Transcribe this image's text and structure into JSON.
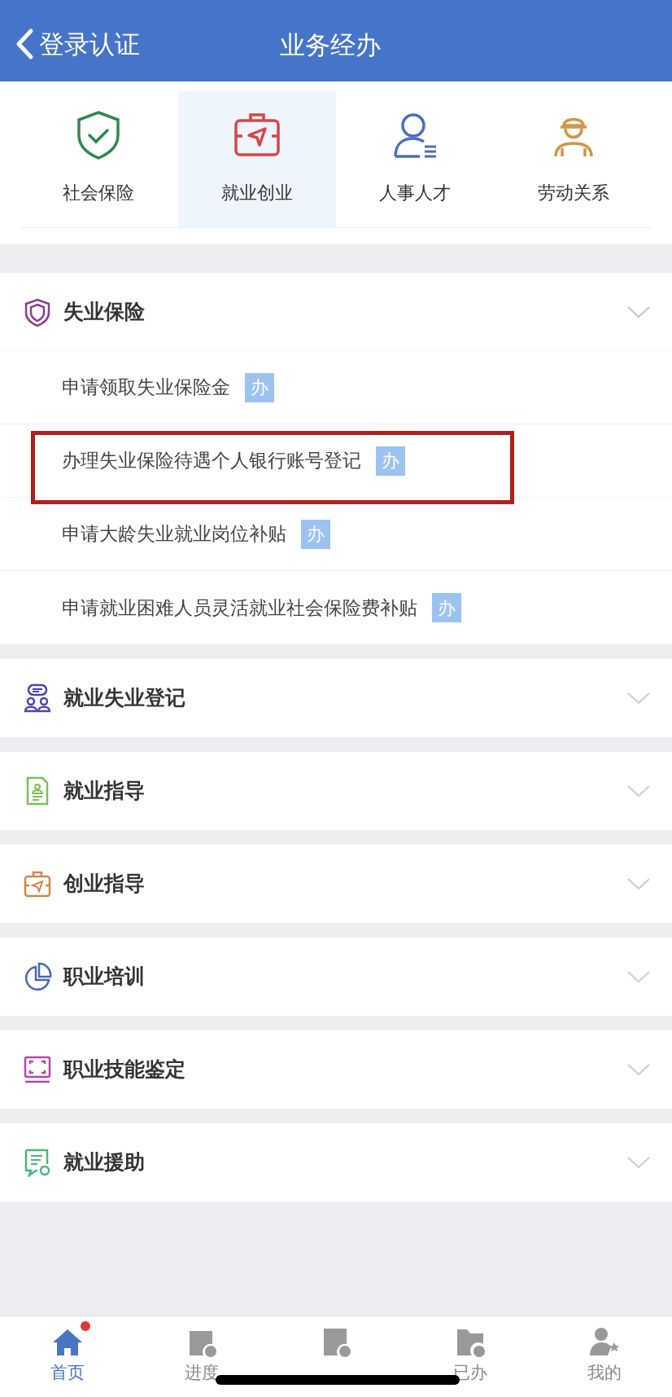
{
  "header": {
    "back_label": "登录认证",
    "title": "业务经办"
  },
  "categories": [
    {
      "label": "社会保险",
      "selected": false
    },
    {
      "label": "就业创业",
      "selected": true
    },
    {
      "label": "人事人才",
      "selected": false
    },
    {
      "label": "劳动关系",
      "selected": false
    }
  ],
  "sections": [
    {
      "title": "失业保险",
      "expanded": true,
      "items": [
        {
          "label": "申请领取失业保险金",
          "badge": "办",
          "highlighted": false
        },
        {
          "label": "办理失业保险待遇个人银行账号登记",
          "badge": "办",
          "highlighted": true
        },
        {
          "label": "申请大龄失业就业岗位补贴",
          "badge": "办",
          "highlighted": false
        },
        {
          "label": "申请就业困难人员灵活就业社会保险费补贴",
          "badge": "办",
          "highlighted": false
        }
      ]
    },
    {
      "title": "就业失业登记",
      "expanded": false
    },
    {
      "title": "就业指导",
      "expanded": false
    },
    {
      "title": "创业指导",
      "expanded": false
    },
    {
      "title": "职业培训",
      "expanded": false
    },
    {
      "title": "职业技能鉴定",
      "expanded": false
    },
    {
      "title": "就业援助",
      "expanded": false
    }
  ],
  "tab_bar": [
    {
      "label": "首页",
      "selected": true,
      "dot": true
    },
    {
      "label": "进度",
      "selected": false,
      "dot": false
    },
    {
      "selected": false,
      "dot": false
    },
    {
      "label": "已办",
      "selected": false,
      "dot": false
    },
    {
      "label": "我的",
      "selected": false,
      "dot": false
    }
  ]
}
